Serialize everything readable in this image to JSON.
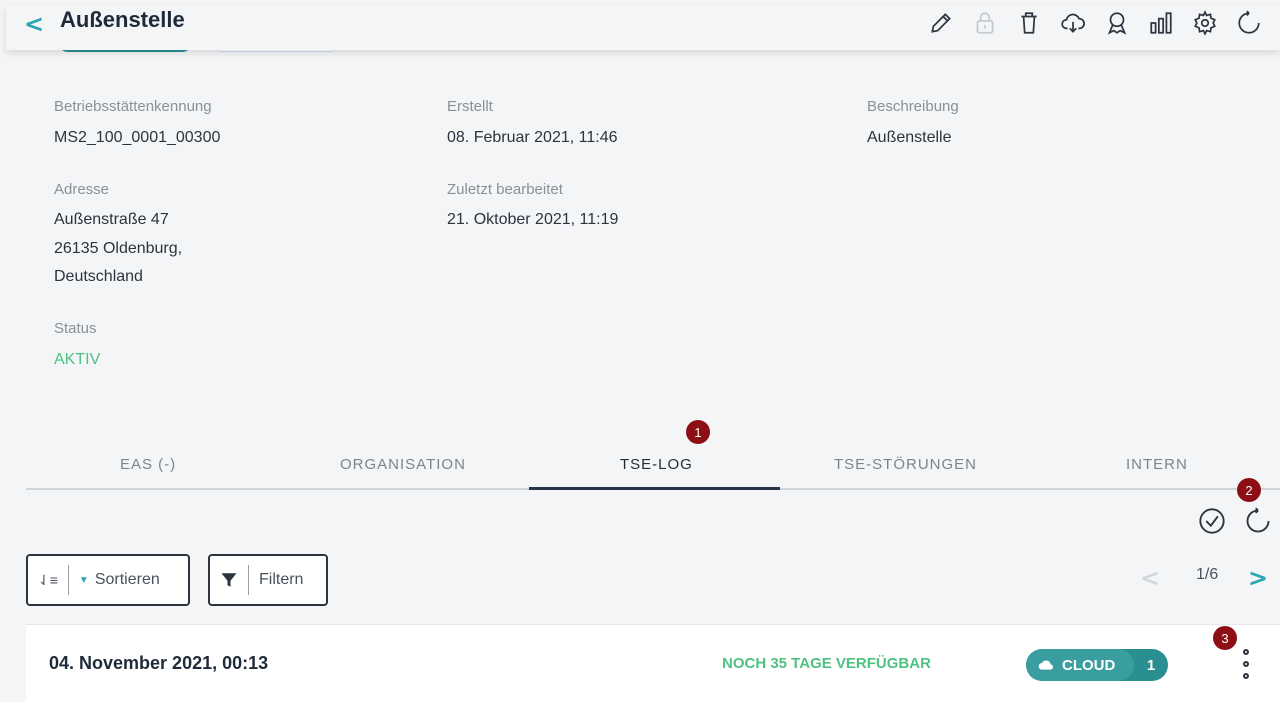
{
  "header": {
    "back_label": "<",
    "title": "Außenstelle"
  },
  "icons": {
    "edit": "pencil-icon",
    "lock": "lock-icon",
    "delete": "trash-icon",
    "download": "cloud-download-icon",
    "certificate": "award-icon",
    "stats": "bar-chart-icon",
    "settings": "gear-icon",
    "refresh": "refresh-icon"
  },
  "details": {
    "betriebsstaette_label": "Betriebsstättenkennung",
    "betriebsstaette_value": "MS2_100_0001_00300",
    "erstellt_label": "Erstellt",
    "erstellt_value": "08. Februar 2021, 11:46",
    "beschreibung_label": "Beschreibung",
    "beschreibung_value": "Außenstelle",
    "adresse_label": "Adresse",
    "adresse_line1": "Außenstraße 47",
    "adresse_line2": "26135  Oldenburg,",
    "adresse_line3": "Deutschland",
    "zuletzt_label": "Zuletzt bearbeitet",
    "zuletzt_value": "21. Oktober 2021, 11:19",
    "status_label": "Status",
    "status_value": "AKTIV"
  },
  "tabs": [
    "EAS (-)",
    "ORGANISATION",
    "TSE-LOG",
    "TSE-STÖRUNGEN",
    "INTERN"
  ],
  "active_tab": "TSE-LOG",
  "badges": [
    "1",
    "2",
    "3"
  ],
  "controls": {
    "sort_label": "Sortieren",
    "filter_label": "Filtern"
  },
  "pagination": {
    "page": "1/6",
    "prev": "<",
    "next": ">"
  },
  "record": {
    "date": "04. November 2021, 00:13",
    "availability": "NOCH 35 TAGE VERFÜGBAR",
    "storage": "CLOUD",
    "count": "1"
  },
  "colors": {
    "accent": "#2aa7b2",
    "active_green": "#4fc282",
    "pill": "#3a9ea1",
    "badge": "#8b0f14"
  }
}
